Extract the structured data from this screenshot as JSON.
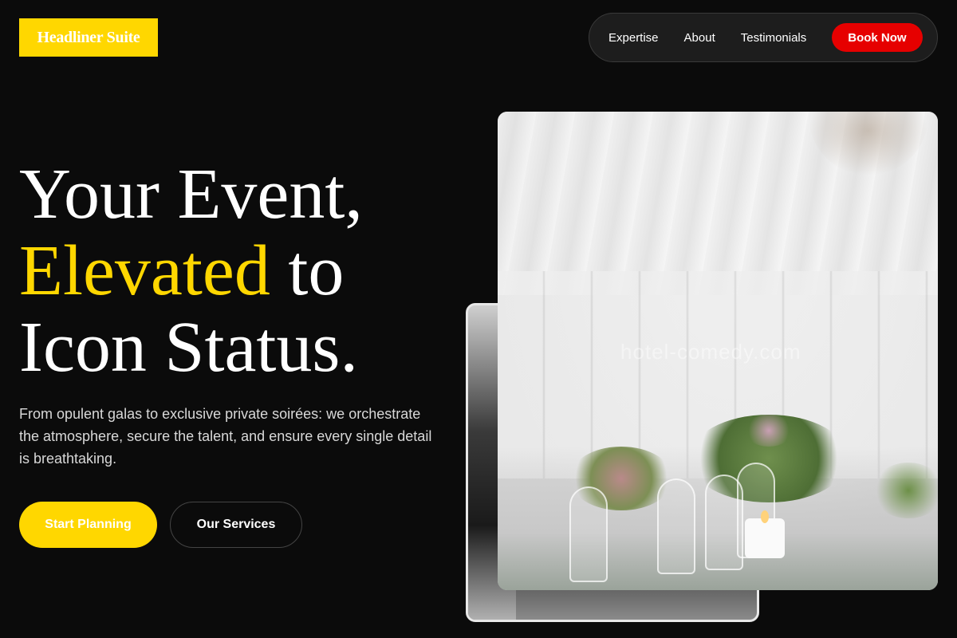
{
  "brand": {
    "logo_text": "Headliner Suite"
  },
  "nav": {
    "links": [
      "Expertise",
      "About",
      "Testimonials"
    ],
    "cta_label": "Book Now"
  },
  "hero": {
    "title_line1": "Your Event,",
    "title_accent": "Elevated",
    "title_after_accent": " to",
    "title_line3": "Icon Status.",
    "description": "From opulent galas to exclusive private soirées: we orchestrate the atmosphere, secure the talent, and ensure every single detail is breathtaking.",
    "primary_button": "Start Planning",
    "secondary_button": "Our Services"
  },
  "images": {
    "watermark_text": "hotel-comedy.com"
  },
  "colors": {
    "background": "#0b0b0b",
    "accent_yellow": "#ffd700",
    "cta_red": "#e60000"
  }
}
